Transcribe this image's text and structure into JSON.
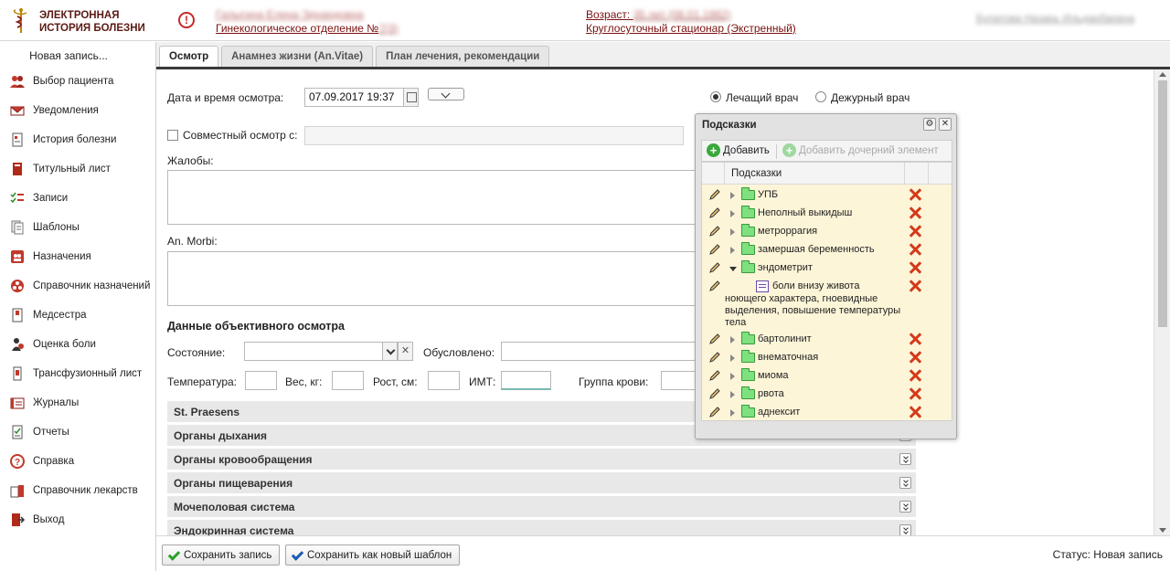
{
  "header": {
    "logo_line1": "ЭЛЕКТРОННАЯ",
    "logo_line2": "ИСТОРИЯ БОЛЕЗНИ",
    "patient_name": "Галыгина Елена Эдуардовна",
    "department": "Гинекологическое отделение №",
    "department_no": "7(3)",
    "age_label": "Возраст:",
    "age_value": "35 лет (06.01.1982)",
    "stay_type": "Круглосуточный стационар (Экстренный)",
    "doctor_name": "Булатова Назарь Ильдарбаевна"
  },
  "sidebar": {
    "new_record": "Новая запись...",
    "items": [
      {
        "label": "Выбор пациента",
        "icon": "patients-icon"
      },
      {
        "label": "Уведомления",
        "icon": "mail-icon"
      },
      {
        "label": "История болезни",
        "icon": "history-icon"
      },
      {
        "label": "Титульный лист",
        "icon": "title-page-icon"
      },
      {
        "label": "Записи",
        "icon": "records-icon"
      },
      {
        "label": "Шаблоны",
        "icon": "templates-icon"
      },
      {
        "label": "Назначения",
        "icon": "prescriptions-icon"
      },
      {
        "label": "Справочник назначений",
        "icon": "prescription-directory-icon"
      },
      {
        "label": "Медсестра",
        "icon": "nurse-icon"
      },
      {
        "label": "Оценка боли",
        "icon": "pain-assessment-icon"
      },
      {
        "label": "Трансфузионный лист",
        "icon": "transfusion-icon"
      },
      {
        "label": "Журналы",
        "icon": "journals-icon"
      },
      {
        "label": "Отчеты",
        "icon": "reports-icon"
      },
      {
        "label": "Справка",
        "icon": "help-icon"
      },
      {
        "label": "Справочник лекарств",
        "icon": "drug-directory-icon"
      },
      {
        "label": "Выход",
        "icon": "exit-icon"
      }
    ]
  },
  "tabs": [
    {
      "label": "Осмотр",
      "active": true
    },
    {
      "label": "Анамнез жизни (An.Vitae)",
      "active": false
    },
    {
      "label": "План лечения, рекомендации",
      "active": false
    }
  ],
  "form": {
    "datetime_label": "Дата и время осмотра:",
    "datetime_value": "07.09.2017 19:37",
    "radio_attending": "Лечащий врач",
    "radio_duty": "Дежурный врач",
    "joint_exam_label": "Совместный осмотр с:",
    "complaints_label": "Жалобы:",
    "anmorbi_label": "An. Morbi:",
    "objective_title": "Данные объективного осмотра",
    "state_label": "Состояние:",
    "caused_label": "Обусловлено:",
    "temp_label": "Температура:",
    "weight_label": "Вес, кг:",
    "height_label": "Рост, см:",
    "bmi_label": "ИМТ:",
    "blood_label": "Группа крови:"
  },
  "sections": [
    "St. Praesens",
    "Органы дыхания",
    "Органы кровообращения",
    "Органы пищеварения",
    "Мочеполовая система",
    "Эндокринная система"
  ],
  "hints": {
    "title": "Подсказки",
    "add": "Добавить",
    "add_child": "Добавить дочерний элемент",
    "column": "Подсказки",
    "rows": [
      {
        "label": "УПБ",
        "type": "folder"
      },
      {
        "label": "Неполный выкидыш",
        "type": "folder"
      },
      {
        "label": "метроррагия",
        "type": "folder"
      },
      {
        "label": "замершая беременность",
        "type": "folder"
      },
      {
        "label": "эндометрит",
        "type": "folder-open"
      },
      {
        "label_line1": "боли внизу живота",
        "label_rest": "ноющего характера, гноевидные выделения, повышение температуры тела",
        "type": "item"
      },
      {
        "label": "бартолинит",
        "type": "folder"
      },
      {
        "label": "внематочная",
        "type": "folder"
      },
      {
        "label": "миома",
        "type": "folder"
      },
      {
        "label": "рвота",
        "type": "folder"
      },
      {
        "label": "аднексит",
        "type": "folder"
      }
    ]
  },
  "footer": {
    "save": "Сохранить запись",
    "save_template": "Сохранить как новый шаблон",
    "status_label": "Статус:",
    "status_value": "Новая запись"
  }
}
